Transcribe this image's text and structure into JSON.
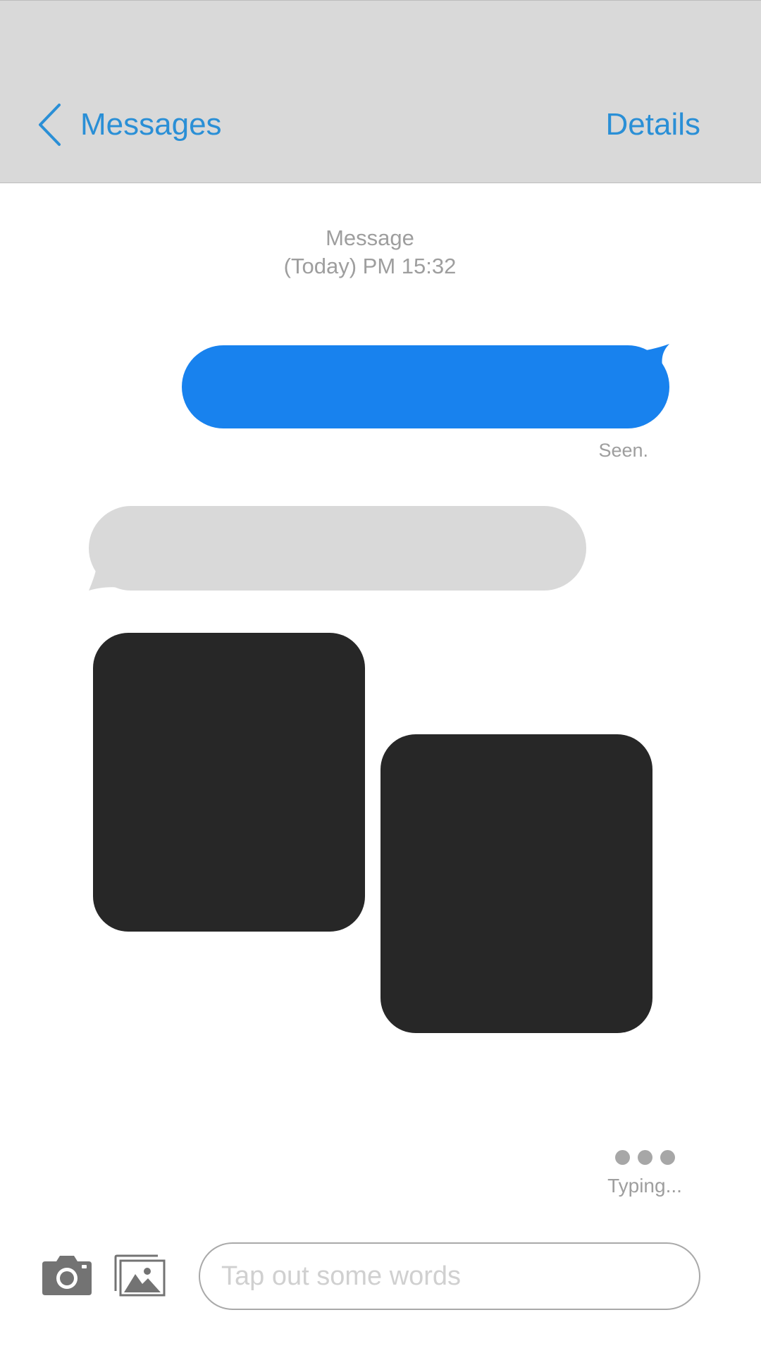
{
  "colors": {
    "header_bg": "#d9d9d9",
    "accent": "#2a8fd6",
    "outgoing_bubble": "#1882ee",
    "incoming_bubble": "#d9d9d9",
    "media_placeholder": "#272727",
    "muted_text": "#9e9e9e"
  },
  "header": {
    "back_icon": "chevron-left-icon",
    "back_label": "Messages",
    "details_label": "Details"
  },
  "conversation": {
    "timestamp_line1": "Message",
    "timestamp_line2": "(Today) PM 15:32",
    "seen_label": "Seen.",
    "typing_label": "Typing..."
  },
  "composer": {
    "camera_icon": "camera-icon",
    "gallery_icon": "gallery-icon",
    "placeholder": "Tap out some words",
    "value": ""
  }
}
